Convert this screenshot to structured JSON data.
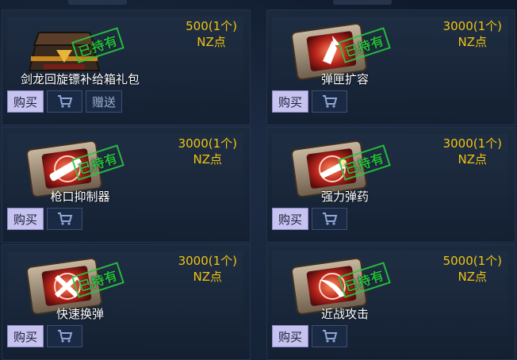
{
  "owned_label": "已持有",
  "buttons": {
    "buy": "购买",
    "gift": "赠送"
  },
  "items": [
    {
      "name": "剑龙回旋镖补给箱礼包",
      "price": "500(1个)",
      "currency": "NZ点",
      "icon": "gift-box-icon",
      "owned": true,
      "has_gift": true
    },
    {
      "name": "弹匣扩容",
      "price": "3000(1个)",
      "currency": "NZ点",
      "icon": "magazine-card-icon",
      "owned": true,
      "has_gift": false
    },
    {
      "name": "枪口抑制器",
      "price": "3000(1个)",
      "currency": "NZ点",
      "icon": "suppressor-card-icon",
      "owned": true,
      "has_gift": false
    },
    {
      "name": "强力弹药",
      "price": "3000(1个)",
      "currency": "NZ点",
      "icon": "ammo-card-icon",
      "owned": true,
      "has_gift": false
    },
    {
      "name": "快速换弹",
      "price": "3000(1个)",
      "currency": "NZ点",
      "icon": "reload-card-icon",
      "owned": true,
      "has_gift": false
    },
    {
      "name": "近战攻击",
      "price": "5000(1个)",
      "currency": "NZ点",
      "icon": "melee-card-icon",
      "owned": true,
      "has_gift": false
    }
  ],
  "colors": {
    "price": "#f1c40f",
    "owned_stamp": "#27c93f",
    "buy_button": "#c6c3ee"
  }
}
